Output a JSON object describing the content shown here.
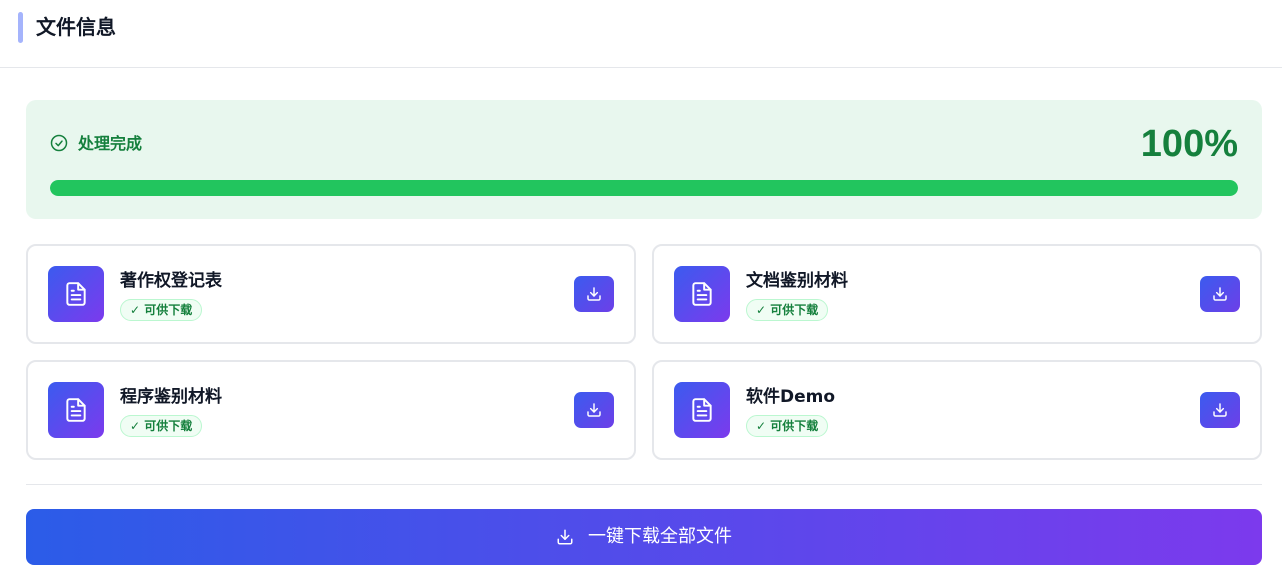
{
  "header": {
    "title": "文件信息"
  },
  "status": {
    "label": "处理完成",
    "percent_text": "100%",
    "progress": 1.0,
    "icon": "check-circle-icon",
    "color": "#15803d",
    "bar_color": "#22c55e",
    "background": "#e8f7ee"
  },
  "files": [
    {
      "name": "著作权登记表",
      "badge": "✓ 可供下载",
      "icon": "document-icon",
      "action_icon": "download-icon"
    },
    {
      "name": "文档鉴别材料",
      "badge": "✓ 可供下载",
      "icon": "document-icon",
      "action_icon": "download-icon"
    },
    {
      "name": "程序鉴别材料",
      "badge": "✓ 可供下载",
      "icon": "document-icon",
      "action_icon": "download-icon"
    },
    {
      "name": "软件Demo",
      "badge": "✓ 可供下载",
      "icon": "document-icon",
      "action_icon": "download-icon"
    }
  ],
  "download_all": {
    "label": "一键下载全部文件",
    "icon": "download-icon"
  },
  "colors": {
    "accent_gradient_start": "#2b5ce8",
    "accent_gradient_end": "#7c3aed",
    "header_accent": "#a5b4fc"
  }
}
